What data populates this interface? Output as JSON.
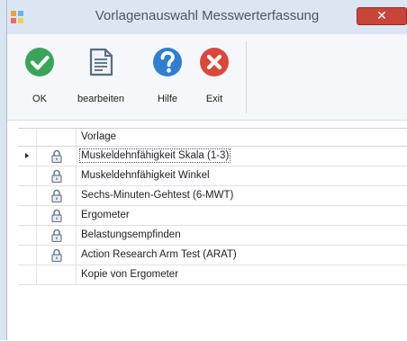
{
  "window": {
    "title": "Vorlagenauswahl Messwerterfassung",
    "close_glyph": "✕"
  },
  "toolbar": {
    "buttons": [
      {
        "label": "OK",
        "icon": "check-icon",
        "color": "#3aa55a"
      },
      {
        "label": "bearbeiten",
        "icon": "document-edit-icon",
        "color": "#5a6b80"
      },
      {
        "label": "Hilfe",
        "icon": "help-icon",
        "color": "#2f7fd0"
      },
      {
        "label": "Exit",
        "icon": "exit-x-icon",
        "color": "#d9483b"
      }
    ]
  },
  "grid": {
    "header": "Vorlage",
    "rows": [
      {
        "label": "Muskeldehnfähigkeit Skala (1-3)",
        "locked": true,
        "selected": true
      },
      {
        "label": "Muskeldehnfähigkeit Winkel",
        "locked": true,
        "selected": false
      },
      {
        "label": "Sechs-Minuten-Gehtest (6-MWT)",
        "locked": true,
        "selected": false
      },
      {
        "label": "Ergometer",
        "locked": true,
        "selected": false
      },
      {
        "label": "Belastungsempfinden",
        "locked": true,
        "selected": false
      },
      {
        "label": "Action Research Arm Test (ARAT)",
        "locked": true,
        "selected": false
      },
      {
        "label": "Kopie von Ergometer",
        "locked": false,
        "selected": false
      }
    ]
  }
}
